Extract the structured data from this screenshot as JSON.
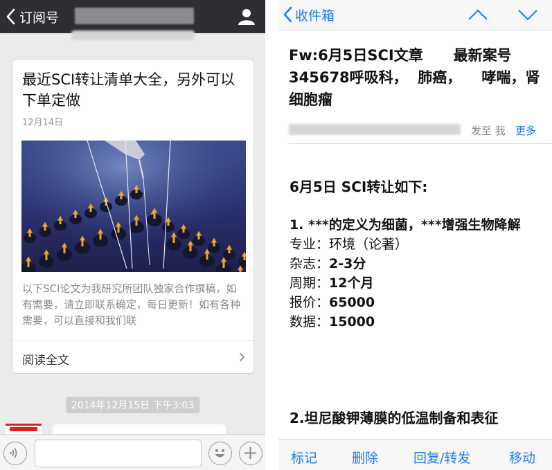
{
  "left": {
    "back_label": "订阅号",
    "card": {
      "title": "最近SCI转让清单大全，另外可以下单定做",
      "date": "12月14日",
      "summary": "以下SCI论文为我研究所团队独家合作撰稿，如有需要，请立即联系确定，每日更新！如有各种需要，可以直接和我们联",
      "read_more": "阅读全文"
    },
    "timestamp": "2014年12月15日 下午3:03"
  },
  "right": {
    "back_label": "收件箱",
    "subject": "Fw:6月5日SCI文章      最新案号345678呼吸科，  肺癌，    哮喘，肾细胞瘤",
    "sent_to_label": "发至 我",
    "more_label": "更多",
    "body": {
      "heading": "6月5日  SCI转让如下:",
      "item1_title": "1. ***的定义为细菌，***增强生物降解",
      "fields": [
        {
          "label": "专业：",
          "value": "环境（论著）"
        },
        {
          "label": "杂志：",
          "value": "2-3分"
        },
        {
          "label": "周期：",
          "value": "12个月"
        },
        {
          "label": "报价：",
          "value": "65000"
        },
        {
          "label": "数据：",
          "value": "15000"
        }
      ],
      "item2_title": "2.坦尼酸钾薄膜的低温制备和表征"
    },
    "toolbar": {
      "flag": "标记",
      "delete": "删除",
      "reply_forward": "回复/转发",
      "move": "移动"
    }
  },
  "colors": {
    "wechat_header": "#2f2f33",
    "wechat_bg": "#ebebeb",
    "ios_blue": "#1a7cf5",
    "timestamp_pill": "#cfcfcf"
  },
  "icons": [
    "back-chevron-icon",
    "user-icon",
    "chevron-right-icon",
    "voice-icon",
    "emoji-icon",
    "plus-icon",
    "chevron-up-icon",
    "chevron-down-icon"
  ]
}
